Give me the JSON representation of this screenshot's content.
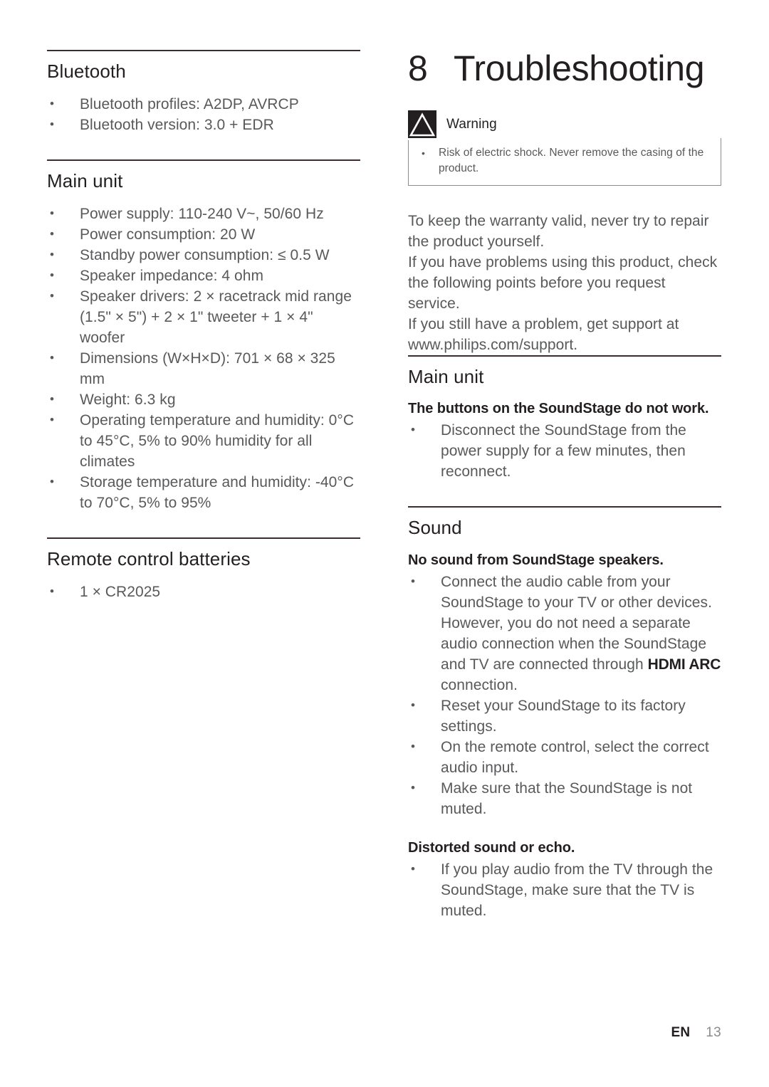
{
  "left_column": {
    "sections": [
      {
        "id": "bluetooth",
        "title": "Bluetooth",
        "bullets": [
          "Bluetooth profiles: A2DP, AVRCP",
          "Bluetooth version: 3.0 + EDR"
        ]
      },
      {
        "id": "main-unit-specs",
        "title": "Main unit",
        "bullets": [
          "Power supply: 110-240 V~, 50/60 Hz",
          "Power consumption: 20 W",
          "Standby power consumption: ≤ 0.5 W",
          "Speaker impedance: 4 ohm",
          "Speaker drivers: 2 × racetrack mid range (1.5\" × 5\") + 2 × 1\" tweeter + 1 × 4\" woofer",
          "Dimensions (W×H×D): 701 × 68 × 325 mm",
          "Weight: 6.3 kg",
          "Operating temperature and humidity: 0°C to 45°C, 5% to 90% humidity for all climates",
          "Storage temperature and humidity: -40°C to 70°C, 5% to 95%"
        ]
      },
      {
        "id": "remote-batteries",
        "title": "Remote control batteries",
        "bullets": [
          "1 × CR2025"
        ]
      }
    ]
  },
  "right_column": {
    "chapter": {
      "number": "8",
      "title": "Troubleshooting"
    },
    "warning": {
      "icon": "warning-triangle-icon",
      "label": "Warning",
      "bullet": "Risk of electric shock. Never remove the casing of the product."
    },
    "intro_lines": [
      "To keep the warranty valid, never try to repair",
      "the product yourself.",
      "If you have problems using this product, check",
      "the following points before you request service.",
      "If you still have a problem, get support at",
      "www.philips.com/support."
    ],
    "sections": [
      {
        "id": "main-unit",
        "title": "Main unit",
        "items": [
          {
            "question": "The buttons on the SoundStage do not work.",
            "bullets": [
              {
                "parts": [
                  {
                    "text": "Disconnect the SoundStage from the power supply for a few minutes, then reconnect.",
                    "emphasis": false
                  }
                ]
              }
            ]
          }
        ]
      },
      {
        "id": "sound",
        "title": "Sound",
        "items": [
          {
            "question": "No sound from SoundStage speakers.",
            "bullets": [
              {
                "parts": [
                  {
                    "text": "Connect the audio cable from your SoundStage to your TV or other devices. However, you do not need a separate audio connection when the SoundStage and TV are connected through ",
                    "emphasis": false
                  },
                  {
                    "text": "HDMI ARC",
                    "emphasis": true
                  },
                  {
                    "text": " connection.",
                    "emphasis": false
                  }
                ]
              },
              {
                "parts": [
                  {
                    "text": "Reset your SoundStage to its factory settings.",
                    "emphasis": false
                  }
                ]
              },
              {
                "parts": [
                  {
                    "text": "On the remote control, select the correct audio input.",
                    "emphasis": false
                  }
                ]
              },
              {
                "parts": [
                  {
                    "text": "Make sure that the SoundStage is not muted.",
                    "emphasis": false
                  }
                ]
              }
            ]
          },
          {
            "question": "Distorted sound or echo.",
            "bullets": [
              {
                "parts": [
                  {
                    "text": "If you play audio from the TV through the SoundStage, make sure that the TV is muted.",
                    "emphasis": false
                  }
                ]
              }
            ]
          }
        ]
      }
    ]
  },
  "footer": {
    "language": "EN",
    "page_number": "13"
  },
  "colors": {
    "rule": "#3b2d2e",
    "heading": "#231f20",
    "body": "#58595b",
    "warning_icon_bg": "#231f20",
    "warning_border": "#8c8c8c",
    "page_number": "#8b8c8e"
  }
}
